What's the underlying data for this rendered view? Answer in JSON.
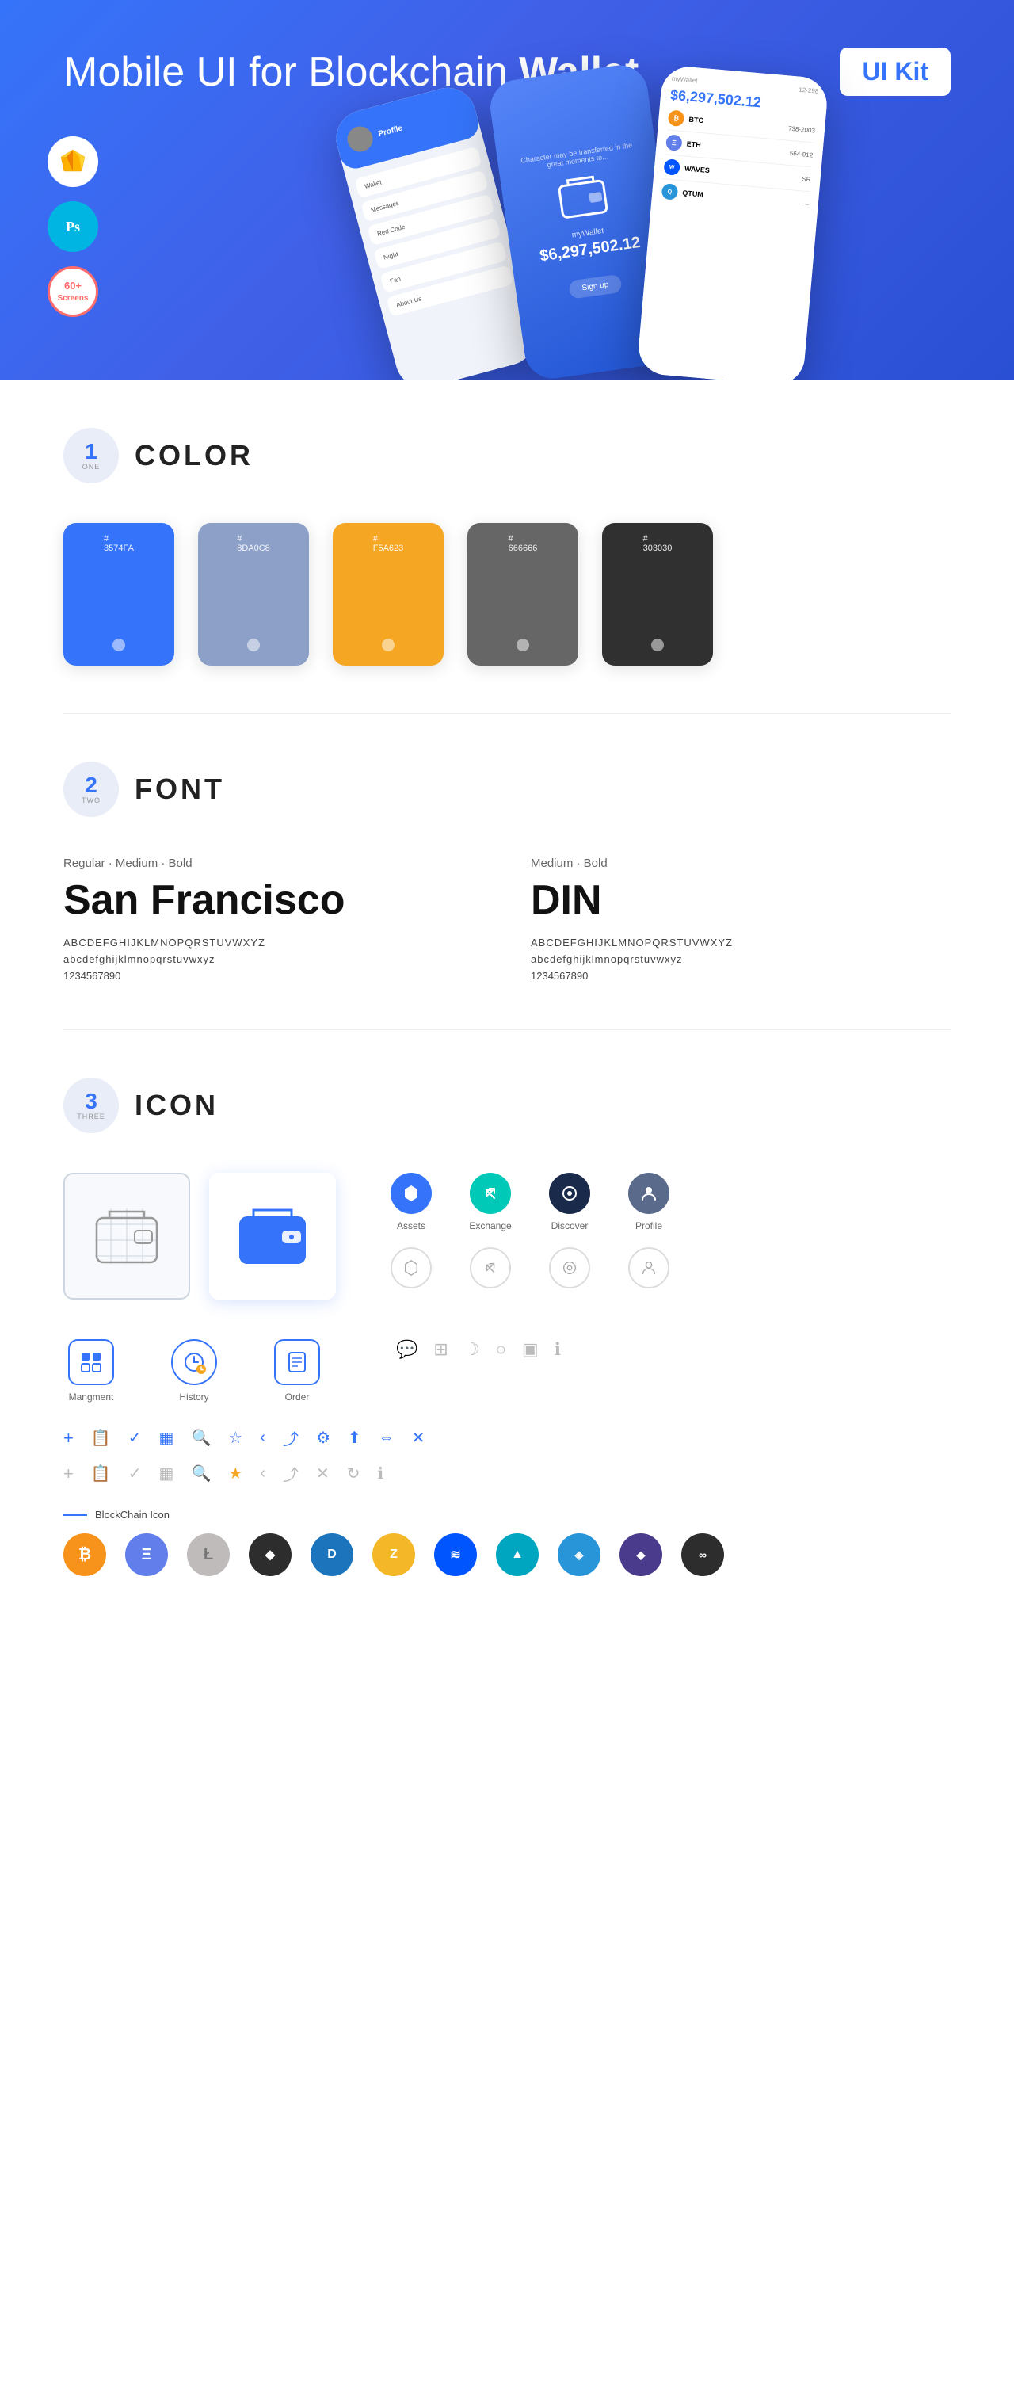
{
  "hero": {
    "title_regular": "Mobile UI for Blockchain ",
    "title_bold": "Wallet",
    "badge": "UI Kit",
    "sketch_label": "Sk",
    "ps_label": "Ps",
    "screens_label": "60+\nScreens"
  },
  "sections": {
    "one": {
      "number": "1",
      "word": "ONE",
      "title": "COLOR",
      "swatches": [
        {
          "color": "#3574FA",
          "hex": "#\n3574FA"
        },
        {
          "color": "#8DA0C8",
          "hex": "#\n8DA0C8"
        },
        {
          "color": "#F5A623",
          "hex": "#\nF5A623"
        },
        {
          "color": "#666666",
          "hex": "#\n666666"
        },
        {
          "color": "#303030",
          "hex": "#\n303030"
        }
      ]
    },
    "two": {
      "number": "2",
      "word": "TWO",
      "title": "FONT",
      "font1": {
        "styles": "Regular · Medium · Bold",
        "name": "San Francisco",
        "upper": "ABCDEFGHIJKLMNOPQRSTUVWXYZ",
        "lower": "abcdefghijklmnopqrstuvwxyz",
        "numbers": "1234567890"
      },
      "font2": {
        "styles": "Medium · Bold",
        "name": "DIN",
        "upper": "ABCDEFGHIJKLMNOPQRSTUVWXYZ",
        "lower": "abcdefghijklmnopqrstuvwxyz",
        "numbers": "1234567890"
      }
    },
    "three": {
      "number": "3",
      "word": "THREE",
      "title": "ICON",
      "nav_icons": [
        {
          "label": "Assets",
          "type": "diamond"
        },
        {
          "label": "Exchange",
          "type": "exchange"
        },
        {
          "label": "Discover",
          "type": "discover"
        },
        {
          "label": "Profile",
          "type": "profile"
        }
      ],
      "app_icons": [
        {
          "label": "Mangment",
          "type": "wallet"
        },
        {
          "label": "History",
          "type": "clock"
        },
        {
          "label": "Order",
          "type": "list"
        }
      ],
      "blockchain_label": "BlockChain Icon",
      "crypto_icons": [
        {
          "label": "BTC",
          "color": "#F7931A",
          "symbol": "₿"
        },
        {
          "label": "ETH",
          "color": "#627EEA",
          "symbol": "Ξ"
        },
        {
          "label": "LTC",
          "color": "#BFBBBB",
          "symbol": "Ł"
        },
        {
          "label": "BAT",
          "color": "#2D2D2D",
          "symbol": "◆"
        },
        {
          "label": "DASH",
          "color": "#1C75BC",
          "symbol": "D"
        },
        {
          "label": "ZEC",
          "color": "#F4B728",
          "symbol": "Z"
        },
        {
          "label": "WAVES",
          "color": "#0155FF",
          "symbol": "⬡"
        },
        {
          "label": "GNO",
          "color": "#00A6C0",
          "symbol": "▲"
        },
        {
          "label": "QTUM",
          "color": "#2895D8",
          "symbol": "◈"
        },
        {
          "label": "POLY",
          "color": "#4B0082",
          "symbol": "◆"
        },
        {
          "label": "EOS",
          "color": "#2D2D2D",
          "symbol": "∞"
        }
      ]
    }
  }
}
